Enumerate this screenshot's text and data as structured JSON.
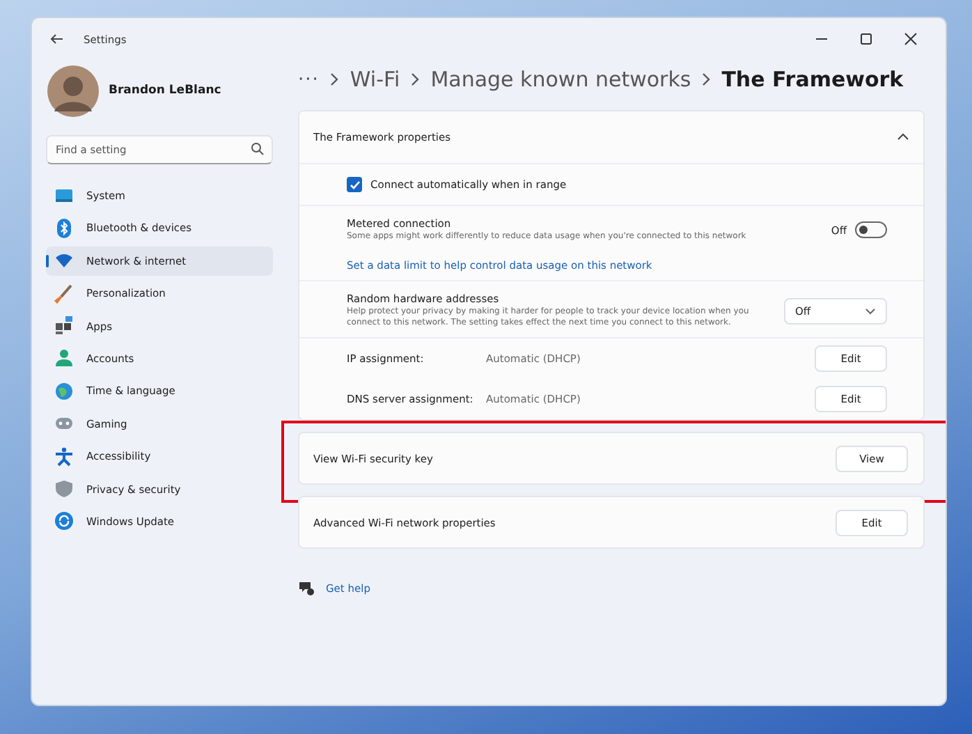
{
  "window": {
    "title": "Settings"
  },
  "user": {
    "name": "Brandon LeBlanc"
  },
  "search": {
    "placeholder": "Find a setting"
  },
  "sidebar": {
    "items": [
      {
        "label": "System",
        "selected": false
      },
      {
        "label": "Bluetooth & devices",
        "selected": false
      },
      {
        "label": "Network & internet",
        "selected": true
      },
      {
        "label": "Personalization",
        "selected": false
      },
      {
        "label": "Apps",
        "selected": false
      },
      {
        "label": "Accounts",
        "selected": false
      },
      {
        "label": "Time & language",
        "selected": false
      },
      {
        "label": "Gaming",
        "selected": false
      },
      {
        "label": "Accessibility",
        "selected": false
      },
      {
        "label": "Privacy & security",
        "selected": false
      },
      {
        "label": "Windows Update",
        "selected": false
      }
    ]
  },
  "breadcrumb": {
    "overflow": "···",
    "items": [
      "Wi-Fi",
      "Manage known networks",
      "The Framework"
    ]
  },
  "properties": {
    "title": "The Framework properties",
    "expanded": true,
    "rows": [
      {
        "kind": "checkbox",
        "label": "Connect automatically when in range",
        "checked": true
      },
      {
        "kind": "toggle",
        "title": "Metered connection",
        "description": "Some apps might work differently to reduce data usage when you're connected to this network",
        "state_text": "Off",
        "on": false,
        "link": "Set a data limit to help control data usage on this network"
      },
      {
        "kind": "dropdown",
        "title": "Random hardware addresses",
        "description": "Help protect your privacy by making it harder for people to track your device location when you connect to this network. The setting takes effect the next time you connect to this network.",
        "value": "Off"
      },
      {
        "kind": "info",
        "label": "IP assignment:",
        "value": "Automatic (DHCP)",
        "button": "Edit"
      },
      {
        "kind": "info",
        "label": "DNS server assignment:",
        "value": "Automatic (DHCP)",
        "button": "Edit"
      }
    ]
  },
  "cards": [
    {
      "label": "View Wi-Fi security key",
      "button": "View",
      "highlighted": true
    },
    {
      "label": "Advanced Wi-Fi network properties",
      "button": "Edit",
      "highlighted": false
    }
  ],
  "help": {
    "link": "Get help"
  }
}
